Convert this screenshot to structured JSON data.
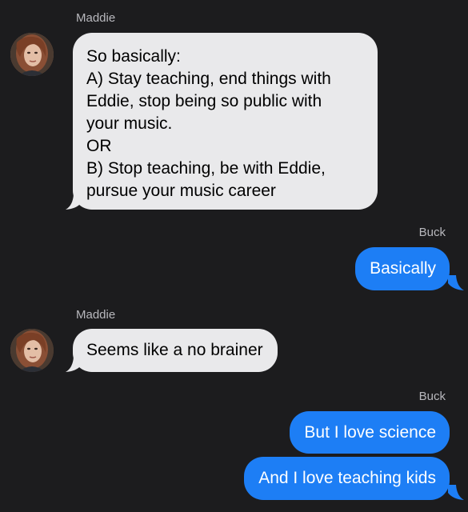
{
  "conversation": {
    "messages": [
      {
        "sender": "Maddie",
        "direction": "incoming",
        "lines": [
          "So basically:",
          "A) Stay teaching, end things with",
          "Eddie, stop being so public with",
          "your music.",
          "OR",
          "B) Stop teaching, be with Eddie,",
          "pursue your music career"
        ]
      },
      {
        "sender": "Buck",
        "direction": "outgoing",
        "text": "Basically"
      },
      {
        "sender": "Maddie",
        "direction": "incoming",
        "text": "Seems like a no brainer"
      },
      {
        "sender": "Buck",
        "direction": "outgoing",
        "text": "But I love science"
      },
      {
        "sender": "Buck",
        "direction": "outgoing",
        "text": "And I love teaching kids"
      }
    ]
  },
  "colors": {
    "background": "#1c1c1e",
    "incoming_bubble": "#e9e9eb",
    "outgoing_bubble": "#1d7ef5",
    "sender_name": "#b8b8bd"
  },
  "icons": {
    "avatar": "contact-photo-maddie"
  }
}
